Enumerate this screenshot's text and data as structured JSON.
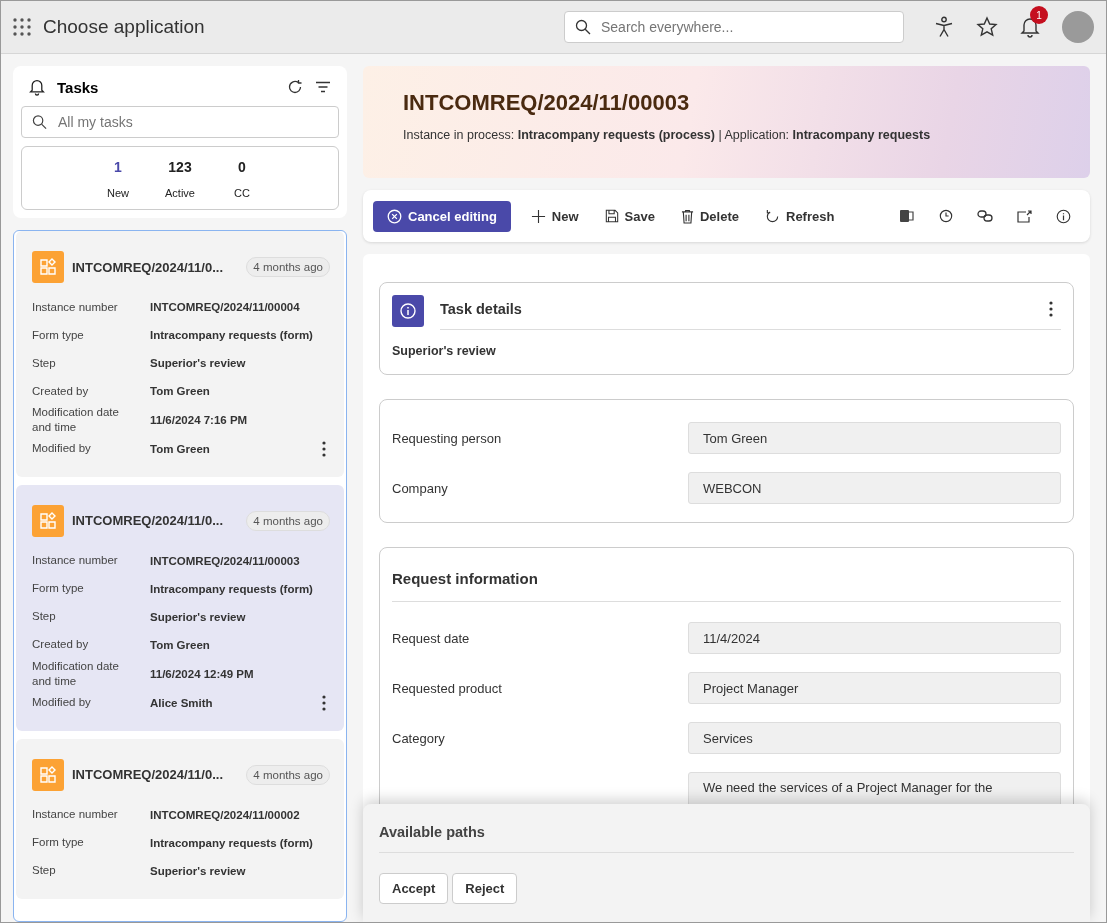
{
  "topbar": {
    "title": "Choose application",
    "search": {
      "placeholder": "Search everywhere..."
    },
    "notification_count": "1"
  },
  "tasks": {
    "title": "Tasks",
    "search": {
      "placeholder": "All my tasks"
    },
    "counters": [
      {
        "value": "1",
        "label": "New",
        "highlight": true
      },
      {
        "value": "123",
        "label": "Active",
        "highlight": false
      },
      {
        "value": "0",
        "label": "CC",
        "highlight": false
      }
    ],
    "cards": [
      {
        "title": "INTCOMREQ/2024/11/0...",
        "age": "4 months ago",
        "selected": false,
        "fields": [
          {
            "label": "Instance number",
            "value": "INTCOMREQ/2024/11/00004"
          },
          {
            "label": "Form type",
            "value": "Intracompany requests (form)"
          },
          {
            "label": "Step",
            "value": "Superior's review"
          },
          {
            "label": "Created by",
            "value": "Tom Green"
          },
          {
            "label": "Modification date and time",
            "value": "11/6/2024 7:16 PM"
          },
          {
            "label": "Modified by",
            "value": "Tom Green"
          }
        ]
      },
      {
        "title": "INTCOMREQ/2024/11/0...",
        "age": "4 months ago",
        "selected": true,
        "fields": [
          {
            "label": "Instance number",
            "value": "INTCOMREQ/2024/11/00003"
          },
          {
            "label": "Form type",
            "value": "Intracompany requests (form)"
          },
          {
            "label": "Step",
            "value": "Superior's review"
          },
          {
            "label": "Created by",
            "value": "Tom Green"
          },
          {
            "label": "Modification date and time",
            "value": "11/6/2024 12:49 PM"
          },
          {
            "label": "Modified by",
            "value": "Alice Smith"
          }
        ]
      },
      {
        "title": "INTCOMREQ/2024/11/0...",
        "age": "4 months ago",
        "selected": false,
        "fields": [
          {
            "label": "Instance number",
            "value": "INTCOMREQ/2024/11/00002"
          },
          {
            "label": "Form type",
            "value": "Intracompany requests (form)"
          },
          {
            "label": "Step",
            "value": "Superior's review"
          }
        ]
      }
    ]
  },
  "header": {
    "title": "INTCOMREQ/2024/11/00003",
    "info": "Instance in process: **Intracompany requests (process)** | Application: **Intracompany requests**"
  },
  "toolbar": {
    "buttons": [
      {
        "kind": "primary",
        "label": "Cancel editing"
      },
      {
        "kind": "new",
        "label": "New"
      },
      {
        "kind": "save",
        "label": "Save"
      },
      {
        "kind": "delete",
        "label": "Delete"
      },
      {
        "kind": "refresh",
        "label": "Refresh"
      }
    ]
  },
  "task_details": {
    "title": "Task details",
    "step": "Superior's review"
  },
  "basic_fields": [
    {
      "label": "Requesting person",
      "value": "Tom Green"
    },
    {
      "label": "Company",
      "value": "WEBCON"
    }
  ],
  "request_information": {
    "title": "Request information",
    "fields": [
      {
        "label": "Request date",
        "value": "11/4/2024"
      },
      {
        "label": "Requested product",
        "value": "Project Manager"
      },
      {
        "label": "Category",
        "value": "Services"
      }
    ],
    "description": {
      "value": "We need the services of a Project Manager for the"
    }
  },
  "paths": {
    "title": "Available paths",
    "buttons": [
      "Accept",
      "Reject"
    ]
  }
}
